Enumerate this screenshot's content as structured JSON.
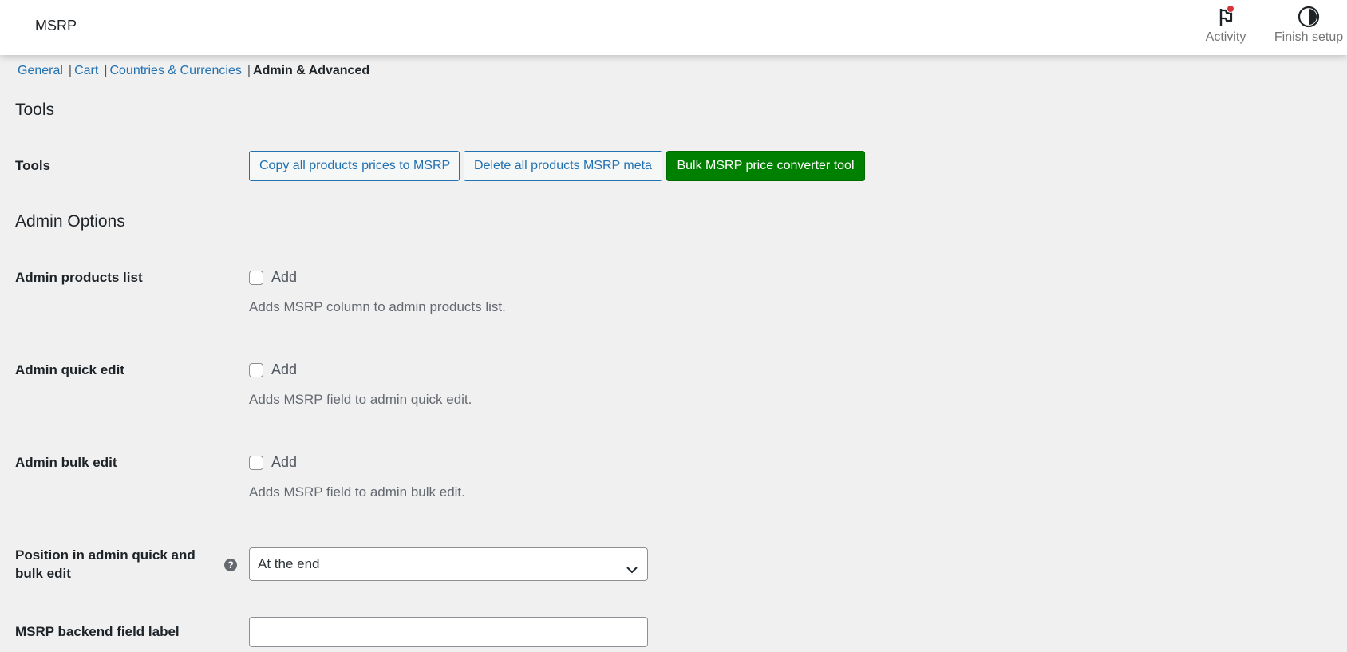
{
  "header": {
    "title": "MSRP",
    "actions": [
      {
        "label": "Activity",
        "icon": "flag-icon",
        "has_notification": true
      },
      {
        "label": "Finish setup",
        "icon": "half-circle-icon"
      }
    ]
  },
  "subnav": {
    "items": [
      {
        "label": "General",
        "current": false
      },
      {
        "label": "Cart",
        "current": false
      },
      {
        "label": "Countries & Currencies",
        "current": false
      },
      {
        "label": "Admin & Advanced",
        "current": true
      }
    ],
    "separator": "|"
  },
  "tools_section": {
    "title": "Tools",
    "row_label": "Tools",
    "buttons": {
      "copy": "Copy all products prices to MSRP",
      "delete": "Delete all products MSRP meta",
      "bulk": "Bulk MSRP price converter tool"
    }
  },
  "admin_section": {
    "title": "Admin Options",
    "products_list": {
      "label": "Admin products list",
      "checkbox_label": "Add",
      "checked": false,
      "description": "Adds MSRP column to admin products list."
    },
    "quick_edit": {
      "label": "Admin quick edit",
      "checkbox_label": "Add",
      "checked": false,
      "description": "Adds MSRP field to admin quick edit."
    },
    "bulk_edit": {
      "label": "Admin bulk edit",
      "checkbox_label": "Add",
      "checked": false,
      "description": "Adds MSRP field to admin bulk edit."
    },
    "position": {
      "label": "Position in admin quick and bulk edit",
      "help_icon": "question-mark-icon",
      "selected": "At the end"
    },
    "backend_label": {
      "label": "MSRP backend field label",
      "value": ""
    }
  },
  "colors": {
    "link": "#2271b1",
    "primary_button": "#008000",
    "background": "#f0f0f1",
    "notification": "#d63638"
  }
}
